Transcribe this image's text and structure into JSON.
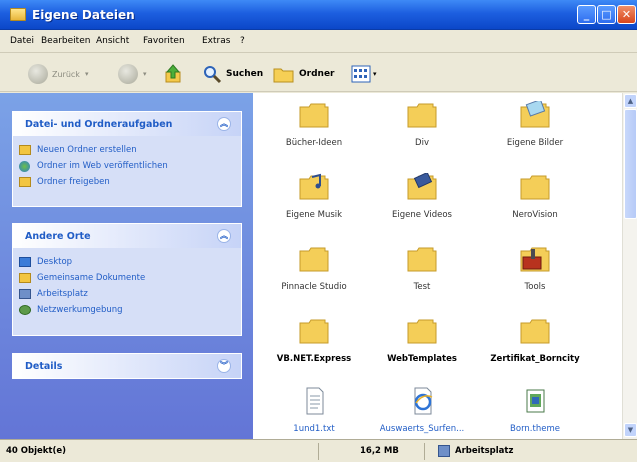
{
  "window": {
    "title": "Eigene Dateien",
    "min_label": "_",
    "max_label": "□",
    "close_label": "✕"
  },
  "menu": [
    "Datei",
    "Bearbeiten",
    "Ansicht",
    "Favoriten",
    "Extras",
    "?"
  ],
  "toolbar": {
    "back_label": "Zurück",
    "search_label": "Suchen",
    "folders_label": "Ordner"
  },
  "left_panel": {
    "tasks": {
      "title": "Datei- und Ordneraufgaben",
      "items": [
        "Neuen Ordner erstellen",
        "Ordner im Web veröffentlichen",
        "Ordner freigeben"
      ]
    },
    "places": {
      "title": "Andere Orte",
      "items": [
        "Desktop",
        "Gemeinsame Dokumente",
        "Arbeitsplatz",
        "Netzwerkumgebung"
      ]
    },
    "details": {
      "title": "Details"
    }
  },
  "files": [
    {
      "name": "Bücher-Ideen",
      "icon": "folder-icon"
    },
    {
      "name": "Div",
      "icon": "folder-icon"
    },
    {
      "name": "Eigene Bilder",
      "icon": "pictures-folder-icon"
    },
    {
      "name": "Eigene Musik",
      "icon": "music-folder-icon"
    },
    {
      "name": "Eigene Videos",
      "icon": "videos-folder-icon"
    },
    {
      "name": "NeroVision",
      "icon": "folder-icon"
    },
    {
      "name": "Pinnacle Studio",
      "icon": "folder-icon"
    },
    {
      "name": "Test",
      "icon": "folder-icon"
    },
    {
      "name": "Tools",
      "icon": "tools-folder-icon"
    },
    {
      "name": "VB.NET.Express",
      "icon": "folder-icon"
    },
    {
      "name": "WebTemplates",
      "icon": "folder-icon"
    },
    {
      "name": "Zertifikat_Borncity",
      "icon": "folder-icon"
    },
    {
      "name": "1und1.txt",
      "icon": "text-file-icon"
    },
    {
      "name": "Auswaerts_Surfen...",
      "icon": "ie-file-icon"
    },
    {
      "name": "Born.theme",
      "icon": "theme-file-icon"
    }
  ],
  "status": {
    "objects": "40 Objekt(e)",
    "size": "16,2 MB",
    "location": "Arbeitsplatz"
  }
}
